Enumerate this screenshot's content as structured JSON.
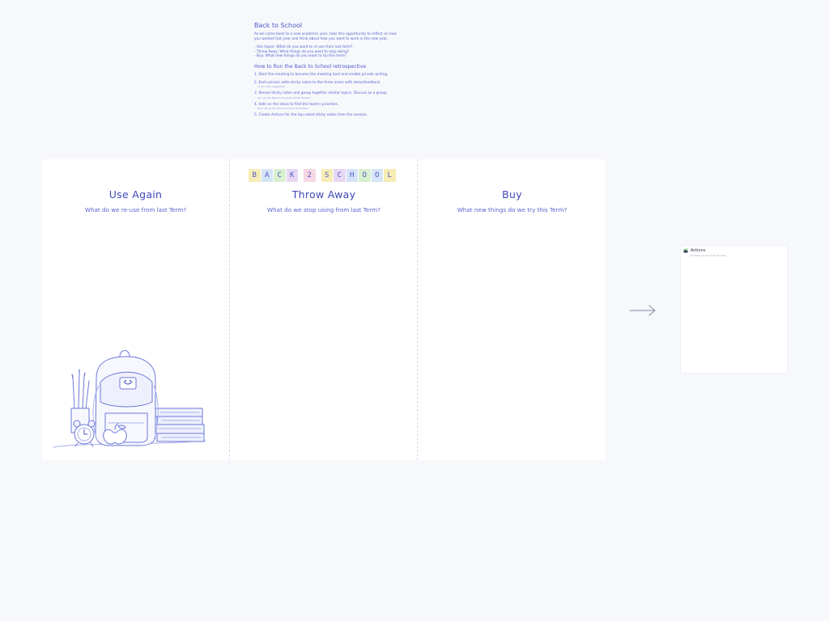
{
  "instructions": {
    "title": "Back to School",
    "intro": "As we come back to a new academic year, take this opportunity to reflect on how you worked last year and think about how you want to work in the new year.",
    "bullets": [
      "- Use Again: What do you want to re-use from last term?",
      "- Throw Away: What things do you want to stop doing?",
      "- Buy: What new things do you want to try this term?"
    ],
    "how_title": "How to Run the Back to School retrospective",
    "steps": [
      {
        "text": "1. Start the meeting to become the meeting host and enable private writing.",
        "note": ""
      },
      {
        "text": "2. Each person adds sticky notes to the three areas with ideas/feedback.",
        "note": "(4 min timer suggested)"
      },
      {
        "text": "3. Reveal sticky notes and group together similar topics. Discuss as a group.",
        "note": "Tip: use the Tags tool to group similar stickies!"
      },
      {
        "text": "4. Vote on the ideas to find the team's priorities.",
        "note": "Hint: Use up the Voting tool from the toolbar!"
      },
      {
        "text": "5. Create Actions for the top-voted sticky notes from the session.",
        "note": ""
      }
    ]
  },
  "banner": {
    "tiles": [
      {
        "letter": "B",
        "color": "#f6edb5"
      },
      {
        "letter": "A",
        "color": "#d6e4f8"
      },
      {
        "letter": "C",
        "color": "#d8f0cf"
      },
      {
        "letter": "K",
        "color": "#e6d8f4"
      },
      {
        "letter": "",
        "color": ""
      },
      {
        "letter": "2",
        "color": "#f6d8e4"
      },
      {
        "letter": "",
        "color": ""
      },
      {
        "letter": "S",
        "color": "#f6edb5"
      },
      {
        "letter": "C",
        "color": "#e6d8f4"
      },
      {
        "letter": "H",
        "color": "#d6e4f8"
      },
      {
        "letter": "O",
        "color": "#d8f0cf"
      },
      {
        "letter": "O",
        "color": "#d6e4f8"
      },
      {
        "letter": "L",
        "color": "#f6edb5"
      }
    ]
  },
  "columns": [
    {
      "heading": "Use Again",
      "subtitle": "What do we re-use from last Term?"
    },
    {
      "heading": "Throw Away",
      "subtitle": "What do we stop using from last Term?"
    },
    {
      "heading": "Buy",
      "subtitle": "What new things do we try this Term?"
    }
  ],
  "illustration": {
    "icon": "backpack-books-clock-illustration"
  },
  "arrow": {
    "icon": "arrow-right-icon"
  },
  "actions": {
    "icon": "clapperboard-icon",
    "title": "Actions",
    "hint": "Add follow-up actions for the team"
  }
}
